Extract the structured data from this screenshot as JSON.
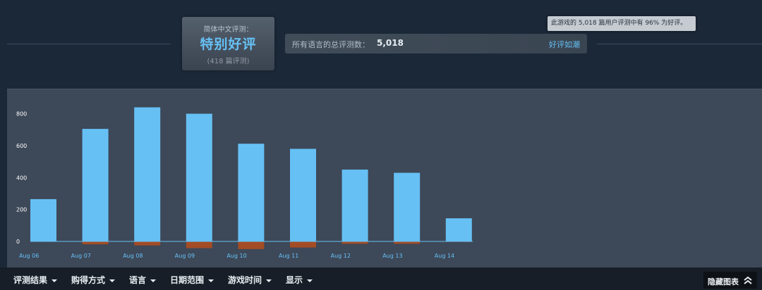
{
  "summary": {
    "language_label": "简体中文评测：",
    "language_rating": "特别好评",
    "language_count": "(418 篇评测)",
    "all_label": "所有语言的总评测数：",
    "all_count": "5,018",
    "all_rating": "好评如潮",
    "tooltip": "此游戏的 5,018 篇用户评测中有 96% 为好评。"
  },
  "colors": {
    "positive": "#66c0f4",
    "negative": "#a34c25",
    "background": "#1b2838",
    "panel": "#3d4858"
  },
  "chart_data": {
    "type": "bar",
    "categories": [
      "Aug 06",
      "Aug 07",
      "Aug 08",
      "Aug 09",
      "Aug 10",
      "Aug 11",
      "Aug 12",
      "Aug 13",
      "Aug 14"
    ],
    "series": [
      {
        "values": [
          265,
          705,
          840,
          800,
          612,
          580,
          450,
          430,
          145
        ]
      },
      {
        "values": [
          0,
          -18,
          -25,
          -42,
          -48,
          -38,
          -15,
          -15,
          -3
        ]
      }
    ],
    "yticks": [
      0,
      200,
      400,
      600,
      800
    ],
    "ylim": [
      -60,
      900
    ],
    "grid": false,
    "legend": "none"
  },
  "filters": [
    "评测结果",
    "购得方式",
    "语言",
    "日期范围",
    "游戏时间",
    "显示"
  ],
  "hide_chart_label": "隐藏图表"
}
